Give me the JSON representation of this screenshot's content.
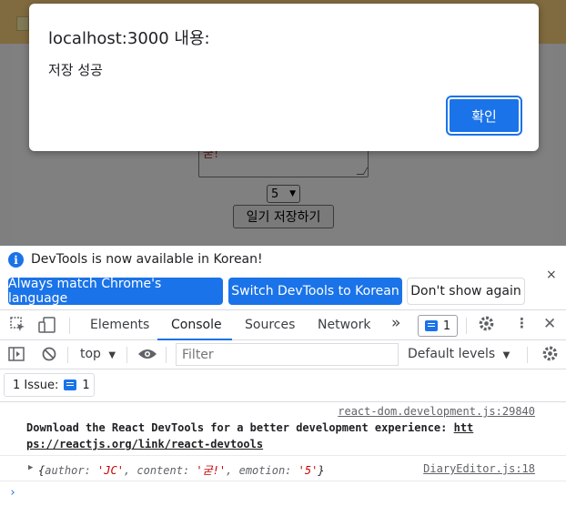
{
  "page": {
    "textarea_text": "굳!",
    "emotion_select": "5",
    "save_button": "일기 저장하기"
  },
  "dialog": {
    "title": "localhost:3000 내용:",
    "message": "저장 성공",
    "ok_label": "확인"
  },
  "devtools": {
    "infobar": {
      "text": "DevTools is now available in Korean!",
      "btn_match": "Always match Chrome's language",
      "btn_switch": "Switch DevTools to Korean",
      "btn_dismiss": "Don't show again",
      "close": "×"
    },
    "tabs": {
      "elements": "Elements",
      "console": "Console",
      "sources": "Sources",
      "network": "Network",
      "more": "»",
      "issues_count": "1"
    },
    "toolbar": {
      "context": "top",
      "filter_placeholder": "Filter",
      "levels": "Default levels"
    },
    "issues_bar": {
      "label": "1 Issue:",
      "count": "1"
    },
    "console": {
      "entry1_source": "react-dom.development.js:29840",
      "entry1_text": "Download the React DevTools for a better development experience: ",
      "entry1_link_part1": "htt",
      "entry1_link_part2": "ps://reactjs.org/link/react-devtools",
      "entry2_source": "DiaryEditor.js:18",
      "entry2": {
        "open": "{",
        "author_key": "author: ",
        "author_val": "'JC'",
        "content_key": ", content: ",
        "content_val": "'굳!'",
        "emotion_key": ", emotion: ",
        "emotion_val": "'5'",
        "close": "}"
      },
      "prompt": "›"
    }
  }
}
